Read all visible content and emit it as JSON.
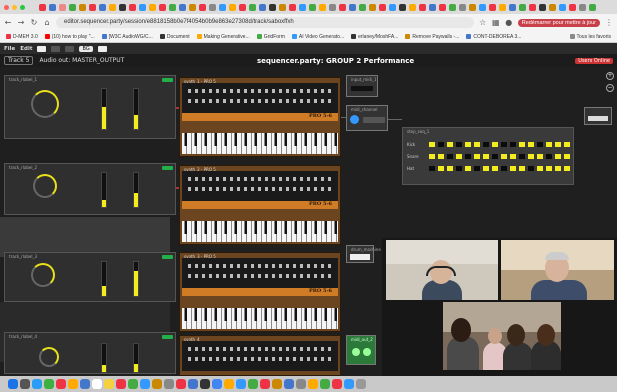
{
  "browser": {
    "url": "editor.sequencer.party/session/e8818158b0e7f4054b0b9e863e27308d/track/saboxffxh",
    "relaunch_label": "Redémarrer pour mettre à jour",
    "bookmarks": [
      "D-MEH 3.0",
      "(10) how to play \"...",
      "[W3C AudioWG/C...",
      "Document",
      "Making Generative...",
      "GridForm",
      "AI Video Generato...",
      "erlaney/MoshFA...",
      "Remove Paywalls -...",
      "CONT-DEBOREA 3..."
    ],
    "bookmarks_right": "Tous les favoris"
  },
  "app": {
    "menu": [
      "File",
      "Edit"
    ],
    "pill_label": "BG",
    "track_label": "Track 5",
    "audio_out": "Audio out: MASTER_OUTPUT",
    "performance_title": "sequencer.party: GROUP 2 Performance",
    "share_label": "Users Online"
  },
  "synth": {
    "brand": "Prophet",
    "model": "PRO 5-6"
  },
  "panels": {
    "left_titles": [
      "track_rlabel_1",
      "track_rlabel_2",
      "track_rlabel_3",
      "track_rlabel_4"
    ],
    "synth_titles": [
      "synth_1 - PRO 5",
      "synth_2 - PRO 5",
      "synth_3 - PRO 5",
      "synth_4"
    ],
    "small_titles": [
      "input_midi_1",
      "midi_channel",
      "drum_machine",
      "midi_out_2"
    ],
    "sequencer_title": "step_seq_1",
    "seq_row_labels": [
      "Kick",
      "Snare",
      "Hat"
    ]
  },
  "meters": {
    "track1": [
      0.55,
      0.35
    ],
    "track2": [
      0.2,
      0.4
    ],
    "track3": [
      0.3,
      0.75
    ],
    "track4": [
      0.25,
      0.3
    ]
  },
  "sequencer": {
    "grid": [
      [
        1,
        0,
        1,
        0,
        1,
        1,
        0,
        1,
        0,
        0,
        1,
        1,
        0,
        1,
        1,
        1
      ],
      [
        1,
        1,
        0,
        1,
        0,
        1,
        1,
        0,
        1,
        1,
        0,
        1,
        1,
        0,
        1,
        1
      ],
      [
        0,
        1,
        1,
        0,
        1,
        0,
        1,
        1,
        0,
        1,
        1,
        0,
        1,
        1,
        1,
        1
      ]
    ],
    "on_color": "#f3ec1f",
    "off_color": "#0b0b0b"
  },
  "colors": {
    "accent_yellow": "#f3ec1f",
    "synth_orange": "#d07b26",
    "online_green": "#23b04a"
  }
}
